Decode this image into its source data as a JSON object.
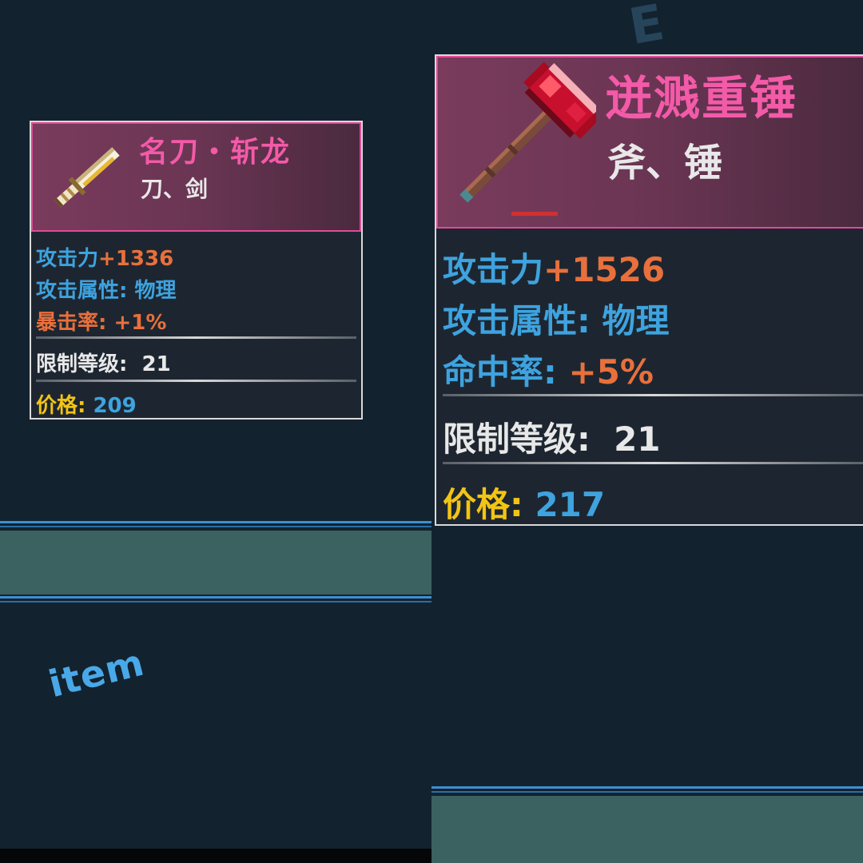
{
  "cards": [
    {
      "name": "名刀・斩龙",
      "type": "刀、剑",
      "attack_label": "攻击力",
      "attack_value": "+1336",
      "attr_label": "攻击属性",
      "attr_value": "物理",
      "extra_label": "暴击率",
      "extra_value": "+1%",
      "level_label": "限制等级",
      "level_value": "21",
      "price_label": "价格",
      "price_value": "209"
    },
    {
      "name": "迸溅重锤",
      "type": "斧、锤",
      "attack_label": "攻击力",
      "attack_value": "+1526",
      "attr_label": "攻击属性",
      "attr_value": "物理",
      "extra_label": "命中率",
      "extra_value": "+5%",
      "level_label": "限制等级",
      "level_value": "21",
      "price_label": "价格",
      "price_value": "217"
    }
  ],
  "watermark": "item",
  "icons": [
    "katana-icon",
    "hammer-icon"
  ],
  "colors": {
    "background": "#13222f",
    "name_pink": "#f35aa8",
    "label_blue": "#3ea3df",
    "value_orange": "#e8703c",
    "price_gold": "#f2c414",
    "teal_band": "#3b6160"
  }
}
